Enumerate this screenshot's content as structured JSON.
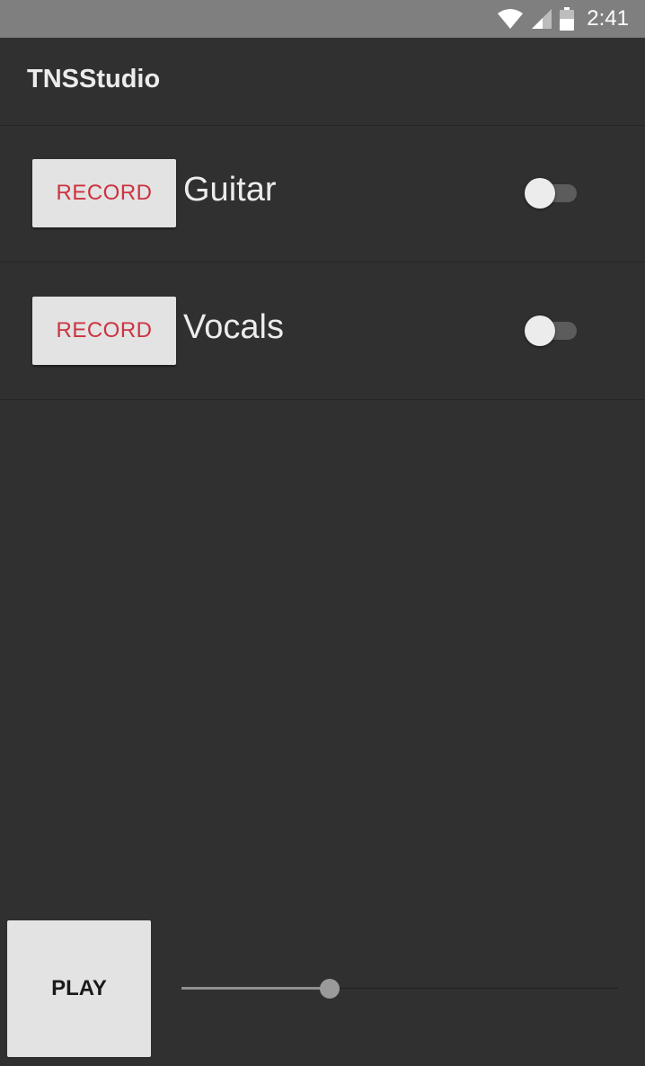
{
  "status_bar": {
    "time": "2:41",
    "icons": [
      "wifi-icon",
      "signal-icon",
      "battery-icon"
    ]
  },
  "app": {
    "title": "TNSStudio"
  },
  "tracks": [
    {
      "record_label": "RECORD",
      "name": "Guitar",
      "enabled": false
    },
    {
      "record_label": "RECORD",
      "name": "Vocals",
      "enabled": false
    }
  ],
  "player": {
    "play_label": "PLAY",
    "slider_position": 0.34
  },
  "colors": {
    "background": "#303030",
    "record_text": "#cc3340",
    "button_bg": "#e3e3e3",
    "text": "#ececec"
  }
}
